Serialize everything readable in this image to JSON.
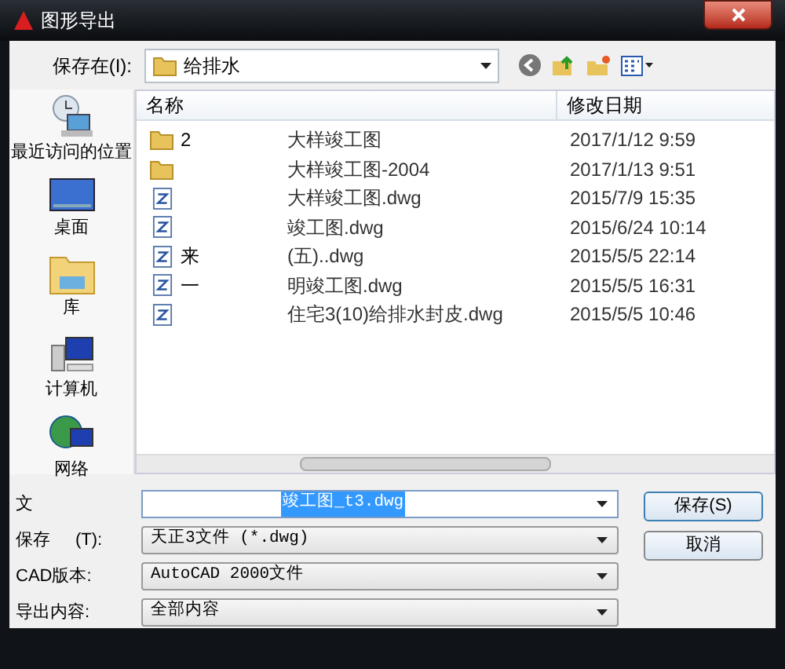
{
  "window": {
    "title": "图形导出"
  },
  "toolbar": {
    "label": "保存在(I):",
    "value": "给排水"
  },
  "places": [
    {
      "kind": "recent",
      "label": "最近访问的位置"
    },
    {
      "kind": "desktop",
      "label": "桌面"
    },
    {
      "kind": "library",
      "label": "库"
    },
    {
      "kind": "computer",
      "label": "计算机"
    },
    {
      "kind": "network",
      "label": "网络"
    }
  ],
  "file_list": {
    "columns": [
      "名称",
      "修改日期"
    ],
    "rows": [
      {
        "kind": "folder",
        "lead": "2",
        "name": "大样竣工图",
        "modified": "2017/1/12 9:59"
      },
      {
        "kind": "folder",
        "name": "大样竣工图-2004",
        "modified": "2017/1/13 9:51"
      },
      {
        "kind": "dwg",
        "name": "大样竣工图.dwg",
        "modified": "2015/7/9 15:35"
      },
      {
        "kind": "dwg",
        "name": "竣工图.dwg",
        "modified": "2015/6/24 10:14"
      },
      {
        "kind": "dwg",
        "lead": "来",
        "name": "(五)..dwg",
        "modified": "2015/5/5 22:14"
      },
      {
        "kind": "dwg",
        "lead": "一",
        "name": "明竣工图.dwg",
        "modified": "2015/5/5 16:31"
      },
      {
        "kind": "dwg",
        "name": "住宅3(10)给排水封皮.dwg",
        "modified": "2015/5/5 10:46"
      }
    ]
  },
  "form": [
    {
      "label": "文",
      "value": "竣工图_t3.dwg",
      "selected": true
    },
    {
      "label": "保存",
      "label_tail": "(T):",
      "value": "天正3文件 (*.dwg)",
      "selected": false
    },
    {
      "label": "CAD版本:",
      "value": "AutoCAD 2000文件",
      "selected": false
    },
    {
      "label": "导出内容:",
      "value": "全部内容",
      "selected": false
    }
  ],
  "buttons": [
    "保存(S)",
    "取消"
  ]
}
